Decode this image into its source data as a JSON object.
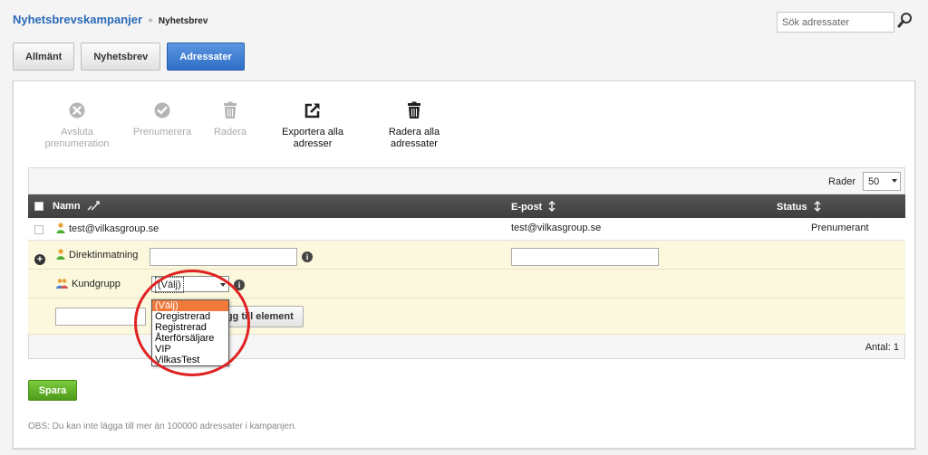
{
  "breadcrumb": {
    "root": "Nyhetsbrevskampanjer",
    "separator": "+",
    "current": "Nyhetsbrev"
  },
  "search": {
    "placeholder": "Sök adressater"
  },
  "tabs": [
    {
      "label": "Allmänt",
      "active": false
    },
    {
      "label": "Nyhetsbrev",
      "active": false
    },
    {
      "label": "Adressater",
      "active": true
    }
  ],
  "actions": {
    "unsubscribe": "Avsluta prenumeration",
    "subscribe": "Prenumerera",
    "delete": "Radera",
    "export_all": "Exportera alla adresser",
    "delete_all": "Radera alla adressater"
  },
  "table": {
    "rows_label": "Rader",
    "rows_value": "50",
    "columns": {
      "name": "Namn",
      "email": "E-post",
      "status": "Status"
    },
    "rows": [
      {
        "name": "test@vilkasgroup.se",
        "email": "test@vilkasgroup.se",
        "status": "Prenumerant"
      }
    ],
    "direct_input_label": "Direktinmatning",
    "customer_group_label": "Kundgrupp",
    "customer_group_value": "(Välj)",
    "add_button": "Lägg till element",
    "count": "Antal: 1"
  },
  "dropdown": {
    "options": [
      "(Välj)",
      "Oregistrerad",
      "Registrerad",
      "Återförsäljare",
      "VIP",
      "VilkasTest"
    ],
    "selected": "(Välj)"
  },
  "save_button": "Spara",
  "note": "OBS: Du kan inte lägga till mer än 100000 adressater i kampanjen.",
  "colors": {
    "accent": "#2f6fc6",
    "link": "#2a6ab8",
    "save": "#5aa523",
    "highlight_circle": "#e02222",
    "dropdown_selected": "#f07a3c"
  }
}
